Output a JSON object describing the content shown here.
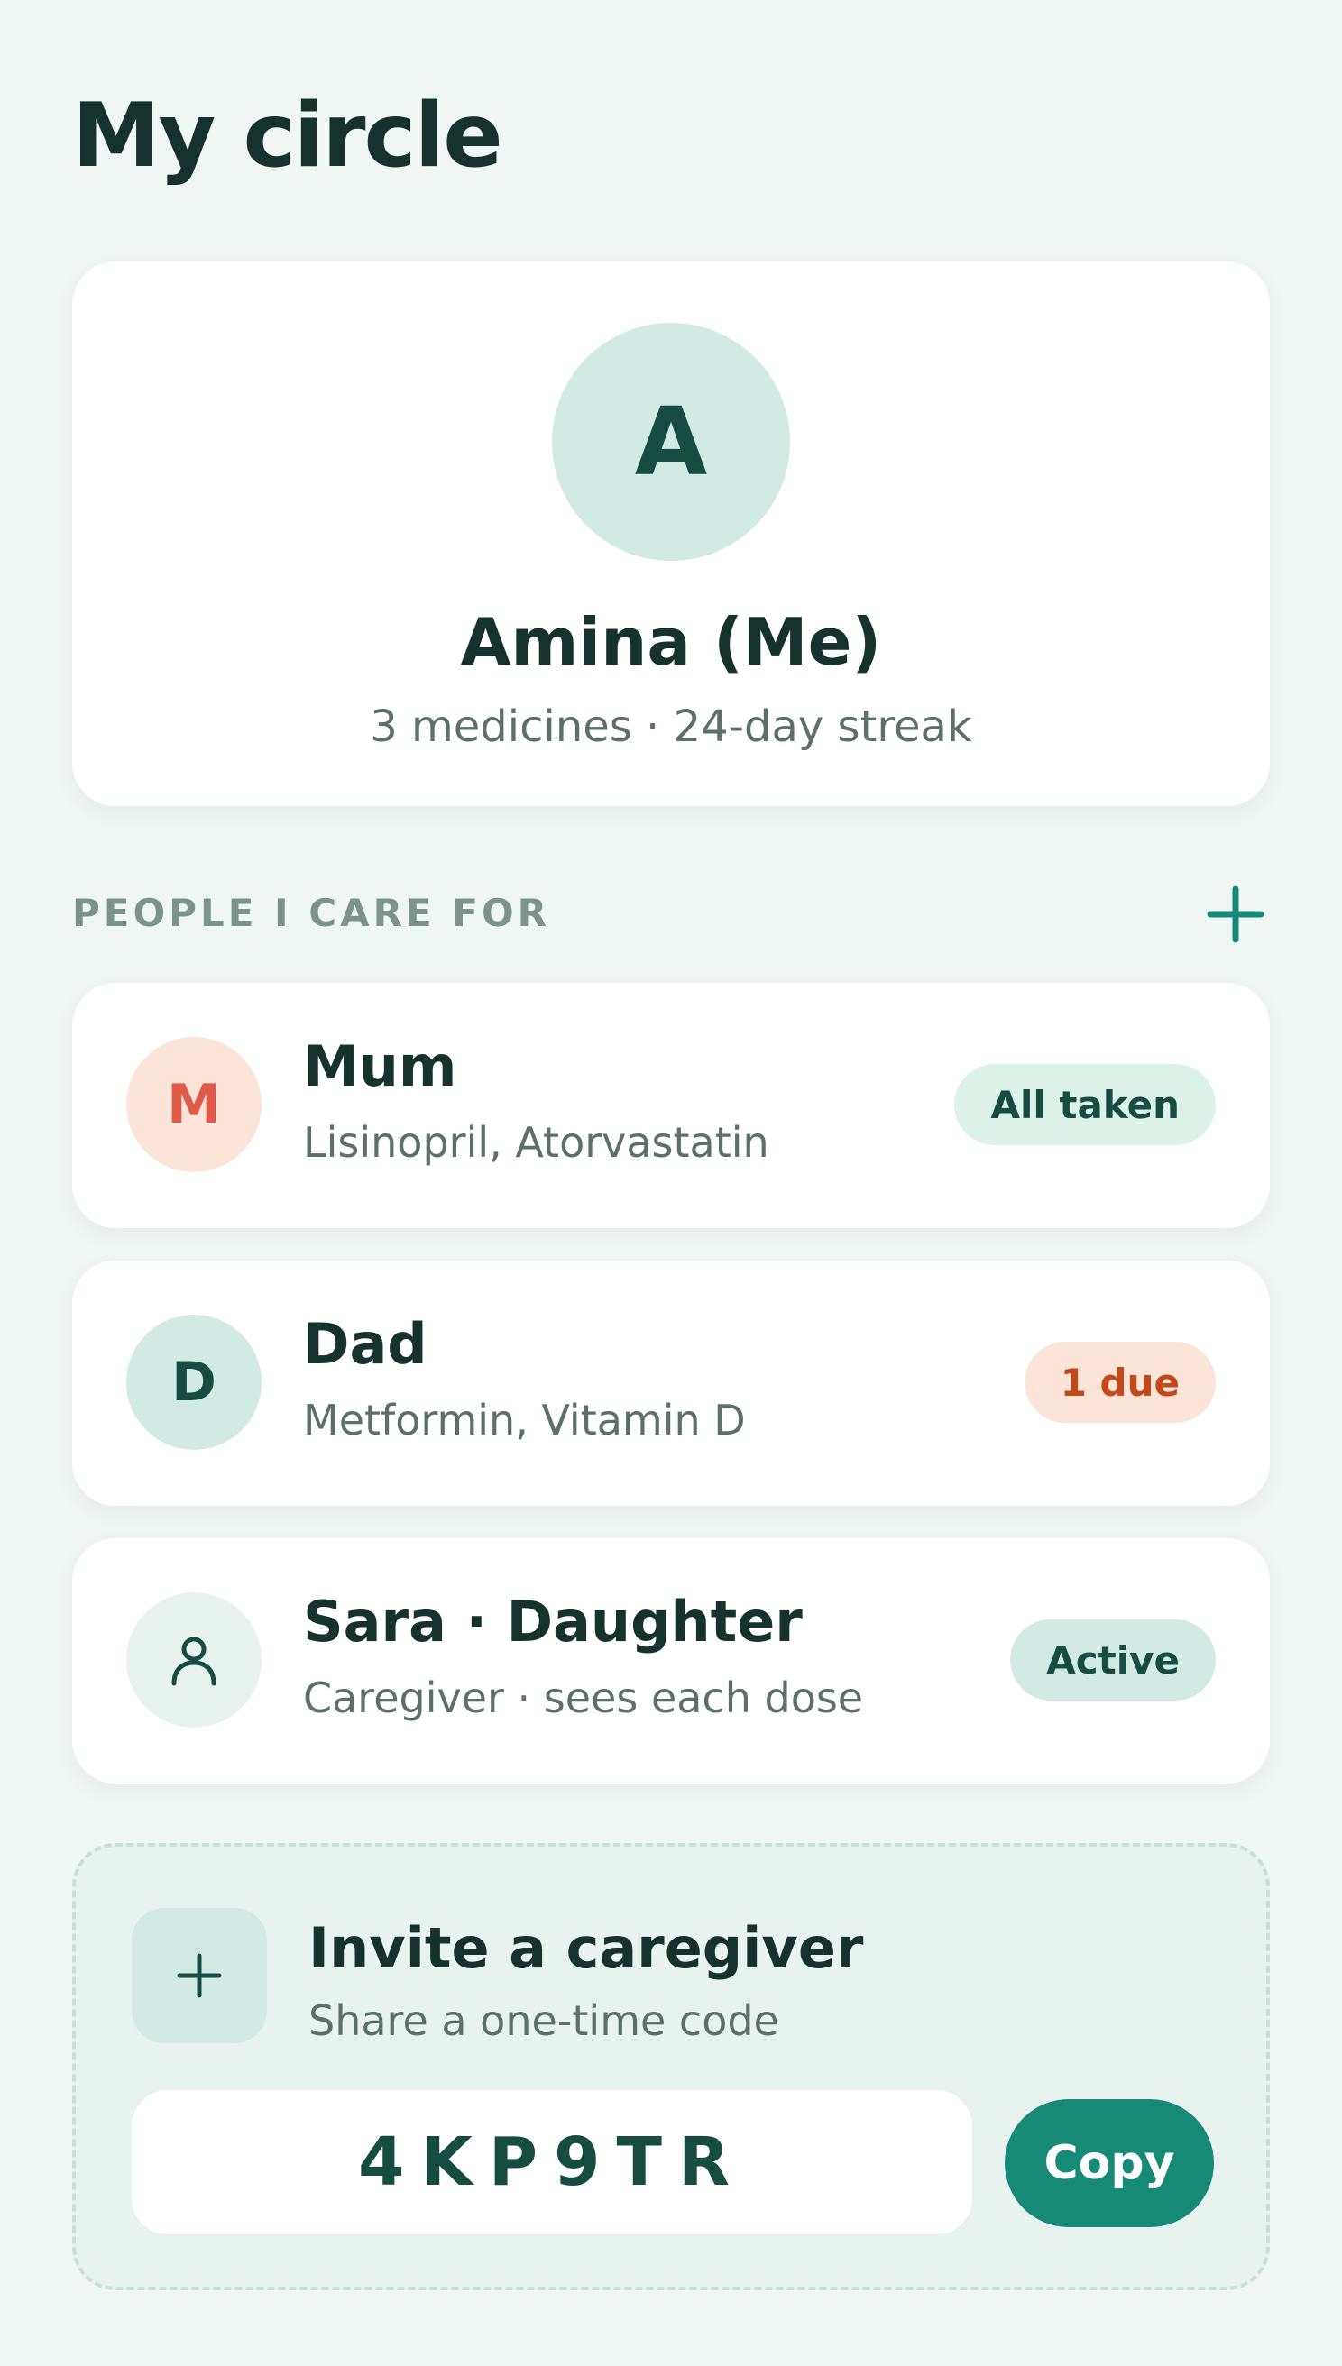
{
  "header": {
    "title": "My circle"
  },
  "profile": {
    "avatar_initial": "A",
    "name": "Amina (Me)",
    "summary": "3 medicines · 24-day streak"
  },
  "section": {
    "label": "PEOPLE I CARE FOR",
    "add_icon": "plus-icon"
  },
  "people": [
    {
      "initial": "M",
      "name": "Mum",
      "meds": "Lisinopril, Atorvastatin",
      "status": "All taken",
      "avatar_bg": "#fce4d9",
      "avatar_fg": "#e05a4a",
      "badge_bg": "#dcf1e8",
      "badge_fg": "#164d40"
    },
    {
      "initial": "D",
      "name": "Dad",
      "meds": "Metformin, Vitamin D",
      "status": "1 due",
      "avatar_bg": "#d2eae4",
      "avatar_fg": "#164d40",
      "badge_bg": "#fce4d9",
      "badge_fg": "#c24a1a"
    },
    {
      "icon": "person-icon",
      "name": "Sara · Daughter",
      "meds": "Caregiver · sees each dose",
      "status": "Active",
      "avatar_bg": "#e8f3f0",
      "badge_bg": "#d2eae4",
      "badge_fg": "#164d40"
    }
  ],
  "invite": {
    "icon": "plus-icon",
    "title": "Invite a caregiver",
    "subtitle": "Share a one-time code",
    "code": "4KP9TR",
    "copy_label": "Copy"
  },
  "colors": {
    "background": "#f0f6f4",
    "accent": "#168a76",
    "text_primary": "#16322c",
    "text_secondary": "#5a7068"
  }
}
